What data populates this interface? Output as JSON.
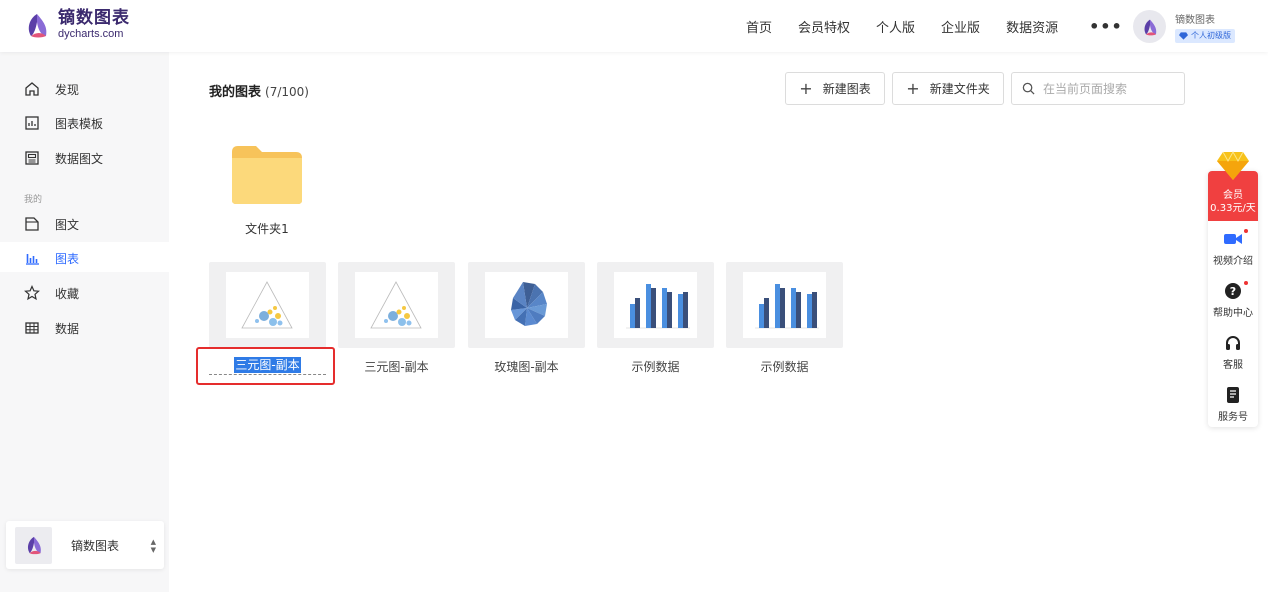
{
  "header": {
    "brand_name": "镝数图表",
    "brand_url": "dycharts.com",
    "nav": [
      "首页",
      "会员特权",
      "个人版",
      "企业版",
      "数据资源"
    ],
    "more": "•••",
    "user_name": "镝数图表",
    "user_level": "个人初级版"
  },
  "sidebar": {
    "items": [
      {
        "label": "发现",
        "icon": "home-icon"
      },
      {
        "label": "图表模板",
        "icon": "chart-template-icon"
      },
      {
        "label": "数据图文",
        "icon": "data-article-icon"
      }
    ],
    "section_title": "我的",
    "my_items": [
      {
        "label": "图文",
        "icon": "article-icon"
      },
      {
        "label": "图表",
        "icon": "bar-chart-icon",
        "active": true
      },
      {
        "label": "收藏",
        "icon": "star-icon"
      },
      {
        "label": "数据",
        "icon": "table-icon"
      }
    ],
    "team_name": "镝数图表"
  },
  "main": {
    "title": "我的图表",
    "count": "(7/100)",
    "new_chart": "新建图表",
    "new_folder": "新建文件夹",
    "search_placeholder": "在当前页面搜索",
    "folder": {
      "label": "文件夹1"
    },
    "charts": [
      {
        "label": "三元图-副本",
        "thumb": "ternary",
        "editing": true
      },
      {
        "label": "三元图-副本",
        "thumb": "ternary"
      },
      {
        "label": "玫瑰图-副本",
        "thumb": "rose"
      },
      {
        "label": "示例数据",
        "thumb": "bar"
      },
      {
        "label": "示例数据",
        "thumb": "bar"
      }
    ]
  },
  "float_panel": {
    "vip_title": "会员",
    "vip_price": "0.33元/天",
    "items": [
      {
        "label": "视频介绍",
        "icon": "video-icon"
      },
      {
        "label": "帮助中心",
        "icon": "help-icon"
      },
      {
        "label": "客服",
        "icon": "headset-icon"
      },
      {
        "label": "服务号",
        "icon": "phone-icon"
      }
    ]
  },
  "colors": {
    "accent": "#2f6bff",
    "highlight": "#e52d2d",
    "folder": "#f9d06b"
  }
}
